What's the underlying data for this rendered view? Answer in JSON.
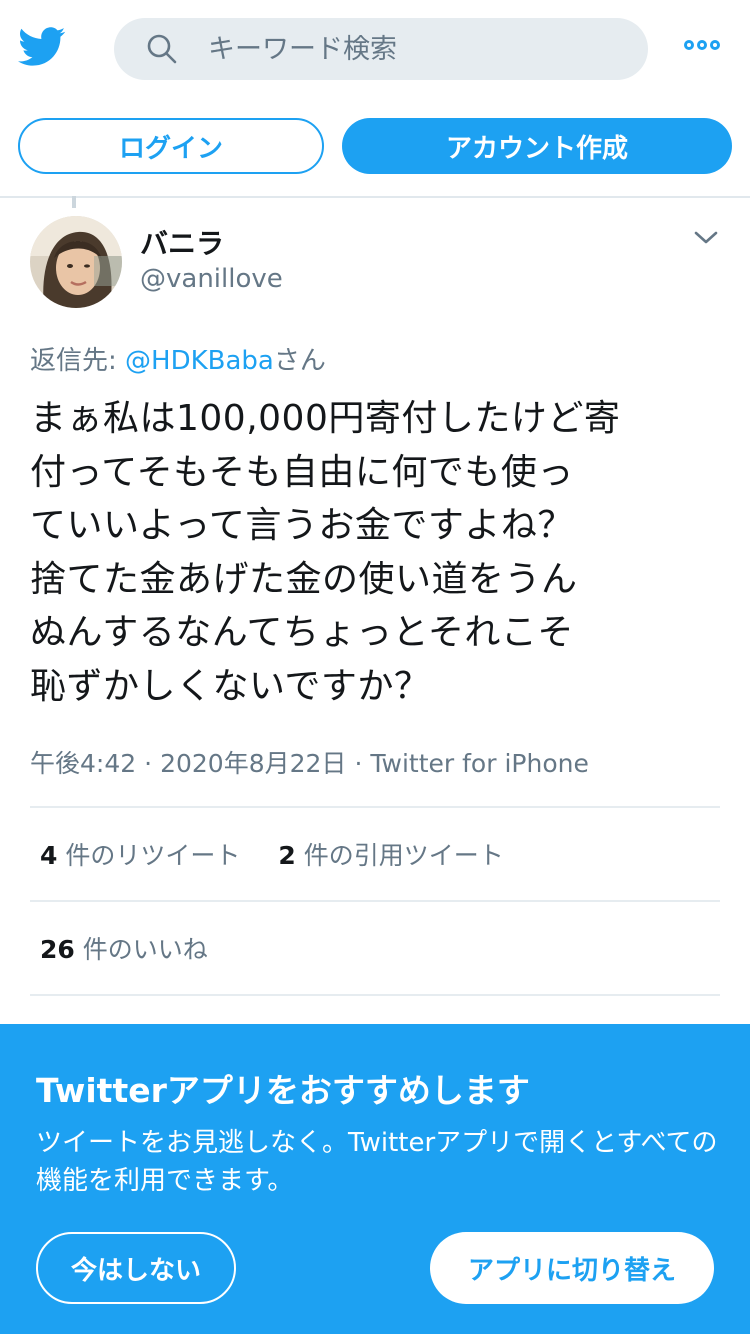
{
  "header": {
    "logo_icon": "twitter-bird-icon",
    "search_placeholder": "キーワード検索",
    "search_icon": "search-icon",
    "more_icon": "more-icon"
  },
  "auth": {
    "login_label": "ログイン",
    "signup_label": "アカウント作成"
  },
  "tweet": {
    "display_name": "バニラ",
    "handle": "@vanillove",
    "reply_prefix": "返信先: ",
    "reply_mention": "@HDKBaba",
    "reply_suffix": "さん",
    "text": "まぁ私は100,000円寄付したけど寄\n付ってそもそも自由に何でも使っ\nていいよって言うお金ですよね？\n捨てた金あげた金の使い道をうん\nぬんするなんてちょっとそれこそ\n恥ずかしくないですか？",
    "time": "午後4:42",
    "date": "2020年8月22日",
    "source": "Twitter for iPhone",
    "retweet_count": "4",
    "retweet_label": " 件のリツイート",
    "quote_count": "2",
    "quote_label": " 件の引用ツイート",
    "like_count": "26",
    "like_label": " 件のいいね"
  },
  "promo": {
    "title": "Twitterアプリをおすすめします",
    "body": "ツイートをお見逃しなく。Twitterアプリで開くとすべての機能を利用できます。",
    "not_now_label": "今はしない",
    "switch_label": "アプリに切り替え"
  },
  "colors": {
    "accent": "#1da1f2",
    "text": "#14171a",
    "muted": "#657786"
  }
}
